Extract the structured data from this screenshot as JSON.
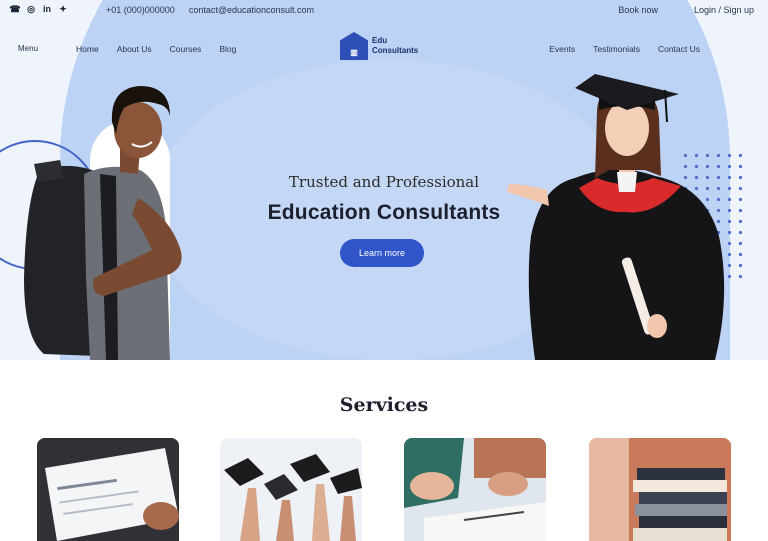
{
  "topbar": {
    "social_icons": [
      "phone-icon",
      "instagram-icon",
      "linkedin-icon",
      "twitter-icon"
    ],
    "email": "+01 (000)000000",
    "phone": "contact@educationconsult.com",
    "right_1": "Book now",
    "right_2": "Login / Sign up"
  },
  "nav": {
    "small": "Menu",
    "left_items": [
      "Home",
      "About Us",
      "Courses",
      "Blog"
    ],
    "logo_text_1": "Edu",
    "logo_text_2": "Consultants",
    "right_items": [
      "Events",
      "Testimonials",
      "Contact Us"
    ]
  },
  "hero": {
    "tagline": "Trusted and Professional",
    "headline": "Education Consultants",
    "cta_label": "Learn more"
  },
  "services": {
    "title": "Services"
  },
  "colors": {
    "accent": "#2f55c9",
    "hero_bg": "#bcd3f5",
    "gown_trim": "#d92b2b"
  }
}
